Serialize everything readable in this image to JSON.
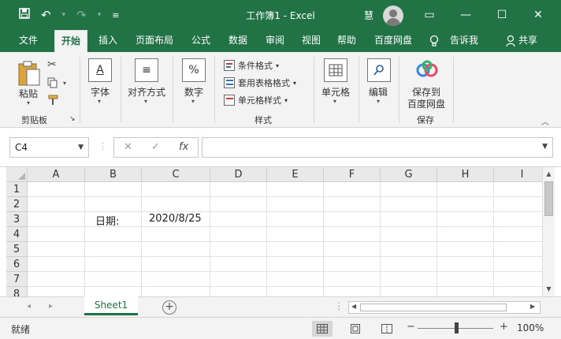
{
  "window": {
    "title": "工作簿1  -  Excel",
    "user": "慧",
    "controls": {
      "ribbon_display": "▭",
      "minimize": "—",
      "restore": "☐",
      "close": "✕"
    }
  },
  "qat": {
    "save_icon": "save-icon",
    "undo_icon": "undo-icon",
    "redo_icon": "redo-icon",
    "customize_icon": "customize-icon"
  },
  "menu": {
    "tabs": [
      "文件",
      "开始",
      "插入",
      "页面布局",
      "公式",
      "数据",
      "审阅",
      "视图",
      "帮助",
      "百度网盘"
    ],
    "active": "开始",
    "tell_me": "告诉我",
    "share": "共享"
  },
  "ribbon": {
    "clipboard": {
      "paste": "粘贴",
      "group": "剪贴板",
      "launcher": "↘"
    },
    "font": {
      "label": "字体"
    },
    "alignment": {
      "label": "对齐方式"
    },
    "number": {
      "label": "数字",
      "symbol": "%"
    },
    "styles": {
      "conditional": "条件格式",
      "table": "套用表格格式",
      "cell_styles": "单元格样式",
      "group": "样式"
    },
    "cells": {
      "label": "单元格"
    },
    "editing": {
      "label": "编辑"
    },
    "baidu": {
      "line1": "保存到",
      "line2": "百度网盘",
      "group": "保存"
    }
  },
  "formula_bar": {
    "name_box": "C4",
    "formula": "",
    "fx": "fx"
  },
  "grid": {
    "columns": [
      "A",
      "B",
      "C",
      "D",
      "E",
      "F",
      "G",
      "H",
      "I"
    ],
    "rows": [
      "1",
      "2",
      "3",
      "4",
      "5",
      "6",
      "7",
      "8"
    ],
    "cells": {
      "B3": "日期:",
      "C3": "2020/8/25"
    }
  },
  "sheets": {
    "tabs": [
      "Sheet1"
    ],
    "active": "Sheet1"
  },
  "status": {
    "mode": "就绪",
    "zoom": "100%",
    "zoom_level": 1.0
  },
  "colors": {
    "accent": "#217346",
    "ribbon_bg": "#f3f3f3",
    "header_bg": "#e9e9e9",
    "gridline": "#e1e1e1"
  }
}
